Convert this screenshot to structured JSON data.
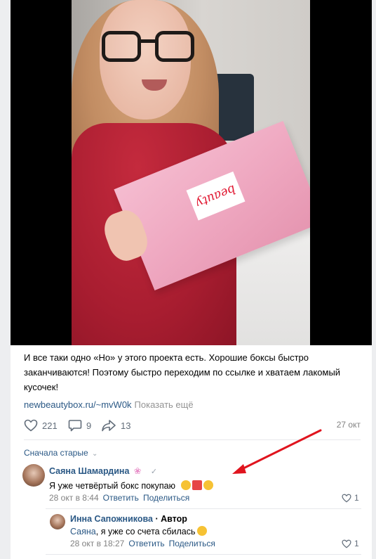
{
  "post": {
    "text": "И все таки одно «Но» у этого проекта есть. Хорошие боксы быстро заканчиваются! Поэтому быстро переходим по ссылке и хватаем лакомый кусочек!",
    "link": "newbeautybox.ru/~mvW0k",
    "show_more": "Показать ещё",
    "box_label": "beauty",
    "likes": "221",
    "comments": "9",
    "shares": "13",
    "date": "27 окт"
  },
  "comments_sort": "Сначала старые",
  "comments": [
    {
      "author": "Саяна Шамардина",
      "text": "Я уже четвёртый бокс покупаю",
      "date": "28 окт в 8:44",
      "reply": "Ответить",
      "share": "Поделиться",
      "likes": "1"
    },
    {
      "author": "Инна Сапожникова",
      "author_badge": "· Автор",
      "reply_to": "Саяна",
      "text": ", я уже со счета сбилась",
      "date": "28 окт в 18:27",
      "reply": "Ответить",
      "share": "Поделиться",
      "likes": "1"
    }
  ],
  "colors": {
    "link": "#2a5885",
    "annotation_arrow": "#e0141e",
    "box_pink": "#f1aec6"
  }
}
